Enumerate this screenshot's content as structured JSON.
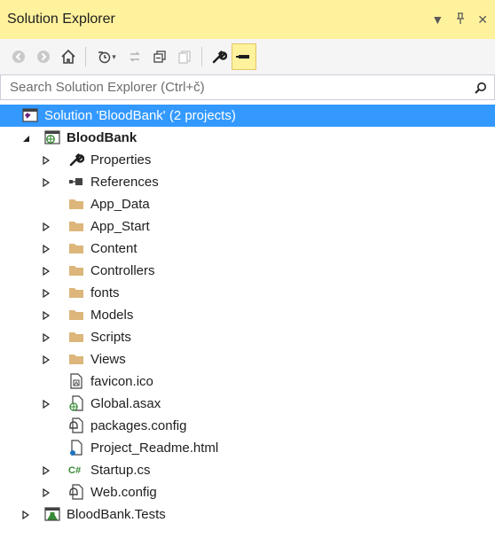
{
  "window": {
    "title": "Solution Explorer",
    "pin_glyph": "▾ ᵖ ✕"
  },
  "search": {
    "placeholder": "Search Solution Explorer (Ctrl+č)"
  },
  "tree": [
    {
      "label": "Solution 'BloodBank' (2 projects)",
      "icon": "solution-icon",
      "expander": "none",
      "level": 0,
      "selected": true
    },
    {
      "label": "BloodBank",
      "icon": "web-project-icon",
      "expander": "expanded",
      "level": 0,
      "bold": true
    },
    {
      "label": "Properties",
      "icon": "wrench-icon",
      "expander": "collapsed",
      "level": 1
    },
    {
      "label": "References",
      "icon": "references-icon",
      "expander": "collapsed",
      "level": 1
    },
    {
      "label": "App_Data",
      "icon": "folder-icon",
      "expander": "none",
      "level": 1
    },
    {
      "label": "App_Start",
      "icon": "folder-icon",
      "expander": "collapsed",
      "level": 1
    },
    {
      "label": "Content",
      "icon": "folder-icon",
      "expander": "collapsed",
      "level": 1
    },
    {
      "label": "Controllers",
      "icon": "folder-icon",
      "expander": "collapsed",
      "level": 1
    },
    {
      "label": "fonts",
      "icon": "folder-icon",
      "expander": "collapsed",
      "level": 1
    },
    {
      "label": "Models",
      "icon": "folder-icon",
      "expander": "collapsed",
      "level": 1
    },
    {
      "label": "Scripts",
      "icon": "folder-icon",
      "expander": "collapsed",
      "level": 1
    },
    {
      "label": "Views",
      "icon": "folder-icon",
      "expander": "collapsed",
      "level": 1
    },
    {
      "label": "favicon.ico",
      "icon": "image-file-icon",
      "expander": "none",
      "level": 1
    },
    {
      "label": "Global.asax",
      "icon": "asax-file-icon",
      "expander": "collapsed",
      "level": 1
    },
    {
      "label": "packages.config",
      "icon": "config-file-icon",
      "expander": "none",
      "level": 1
    },
    {
      "label": "Project_Readme.html",
      "icon": "html-file-icon",
      "expander": "none",
      "level": 1
    },
    {
      "label": "Startup.cs",
      "icon": "csharp-file-icon",
      "expander": "collapsed",
      "level": 1
    },
    {
      "label": "Web.config",
      "icon": "config-file-icon",
      "expander": "collapsed",
      "level": 1
    },
    {
      "label": "BloodBank.Tests",
      "icon": "test-project-icon",
      "expander": "collapsed",
      "level": 0
    }
  ],
  "colors": {
    "title_bg": "#fff29d",
    "selection": "#3399ff",
    "folder": "#dcb67a"
  }
}
